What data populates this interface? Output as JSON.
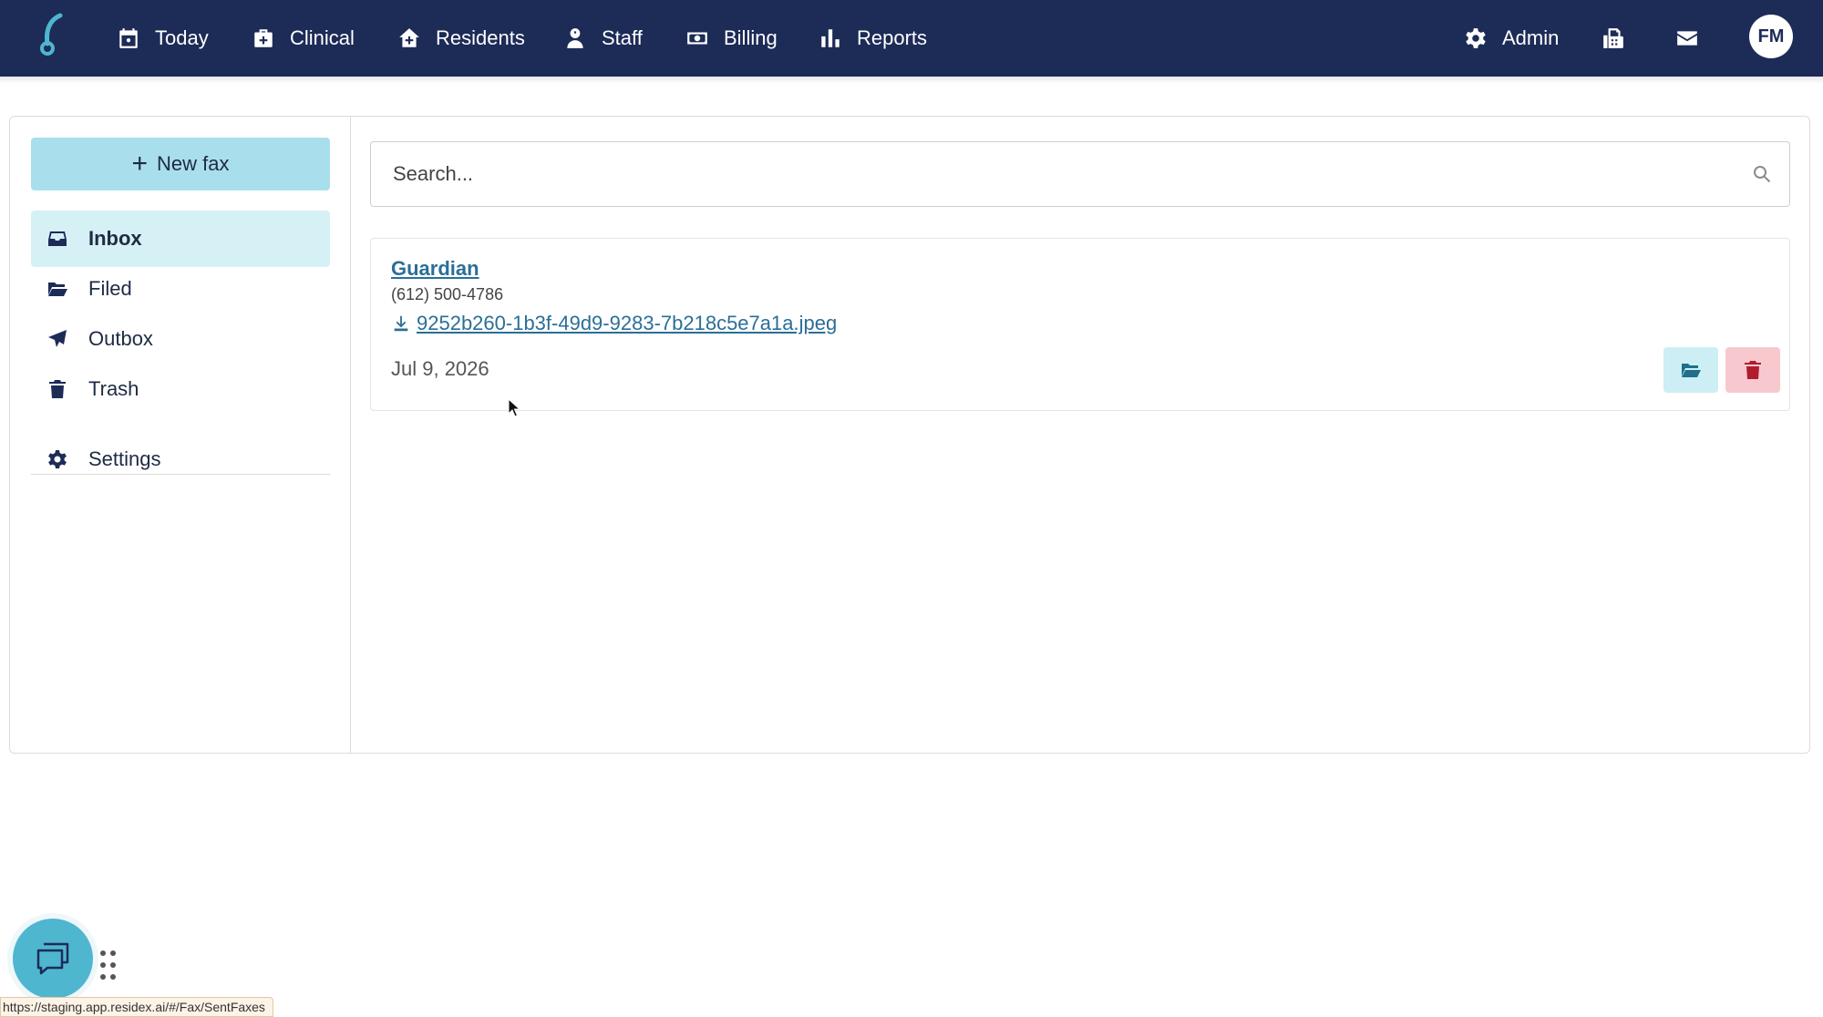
{
  "nav": {
    "items": [
      {
        "label": "Today",
        "icon": "calendar-icon"
      },
      {
        "label": "Clinical",
        "icon": "clinical-icon"
      },
      {
        "label": "Residents",
        "icon": "house-icon"
      },
      {
        "label": "Staff",
        "icon": "staff-icon"
      },
      {
        "label": "Billing",
        "icon": "money-icon"
      },
      {
        "label": "Reports",
        "icon": "bar-chart-icon"
      }
    ],
    "admin_label": "Admin",
    "avatar_initials": "FM"
  },
  "sidebar": {
    "new_fax_label": "New fax",
    "items": [
      {
        "label": "Inbox",
        "icon": "inbox-icon",
        "active": true
      },
      {
        "label": "Filed",
        "icon": "folder-open-icon"
      },
      {
        "label": "Outbox",
        "icon": "paper-plane-icon"
      },
      {
        "label": "Trash",
        "icon": "trash-icon"
      },
      {
        "label": "Settings",
        "icon": "gear-icon"
      }
    ]
  },
  "search": {
    "placeholder": "Search..."
  },
  "faxes": [
    {
      "sender": "Guardian",
      "number": "(612) 500-4786",
      "file": "9252b260-1b3f-49d9-9283-7b218c5e7a1a.jpeg",
      "date": "Jul 9, 2026"
    }
  ],
  "status_bar_url": "https://staging.app.residex.ai/#/Fax/SentFaxes",
  "colors": {
    "nav_bg": "#1d2b57",
    "accent": "#a9dfec",
    "active_bg": "#d6f1f6",
    "link": "#2a6f97",
    "delete": "#b01c2e"
  }
}
